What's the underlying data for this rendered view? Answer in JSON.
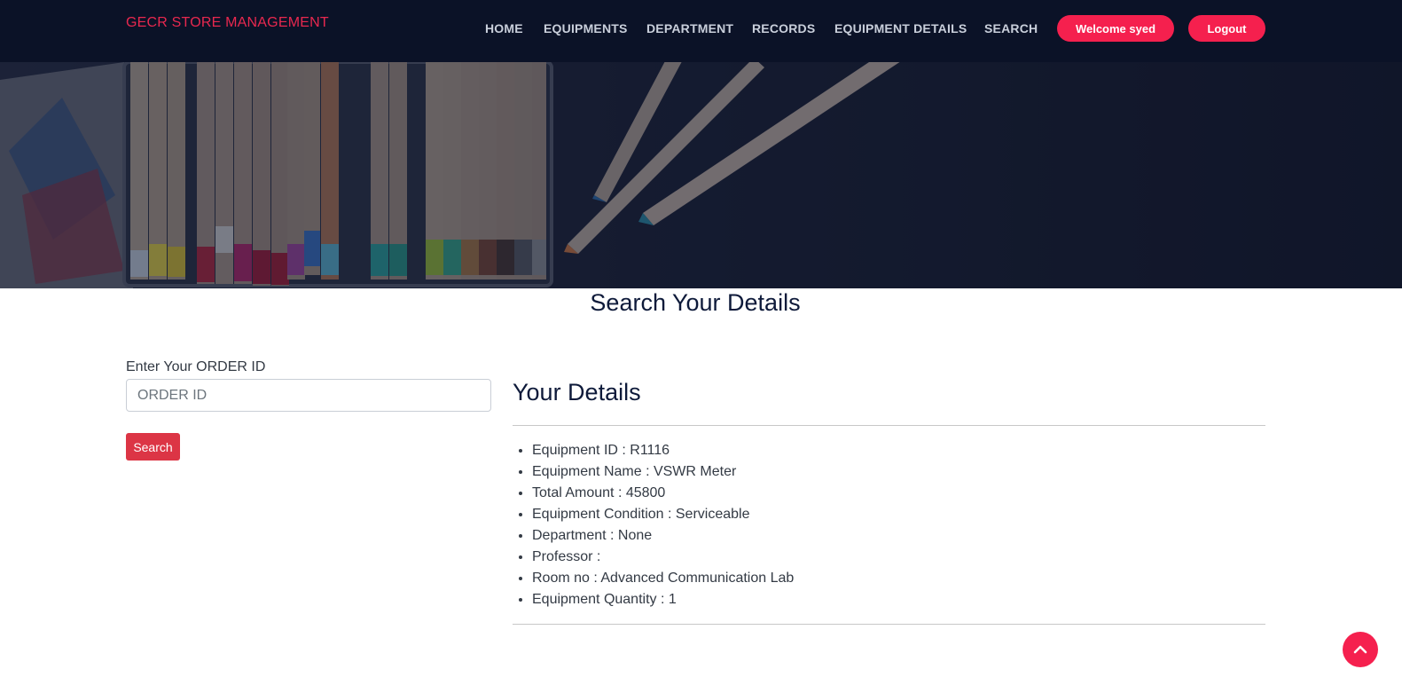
{
  "brand": "GECR STORE MANAGEMENT",
  "nav": {
    "items": [
      {
        "label": "HOME"
      },
      {
        "label": "EQUIPMENTS"
      },
      {
        "label": "DEPARTMENT"
      },
      {
        "label": "RECORDS"
      },
      {
        "label": "EQUIPMENT DETAILS"
      },
      {
        "label": "SEARCH"
      }
    ],
    "welcome": "Welcome syed",
    "logout": "Logout"
  },
  "page_title": "Search Your Details",
  "search_form": {
    "label": "Enter Your ORDER ID",
    "placeholder": "ORDER ID",
    "value": "",
    "button": "Search"
  },
  "details": {
    "title": "Your Details",
    "items": [
      "Equipment ID : R1116",
      "Equipment Name : VSWR Meter",
      "Total Amount : 45800",
      "Equipment Condition : Serviceable",
      "Department : None",
      "Professor :",
      "Room no : Advanced Communication Lab",
      "Equipment Quantity : 1"
    ]
  },
  "icons": {
    "scroll_top": "chevron-up-icon"
  },
  "colors": {
    "navbar_bg": "#0b1227",
    "accent": "#f5204e",
    "brand_text": "#e8284f",
    "search_button": "#dc3545",
    "heading": "#0e1a3a"
  }
}
